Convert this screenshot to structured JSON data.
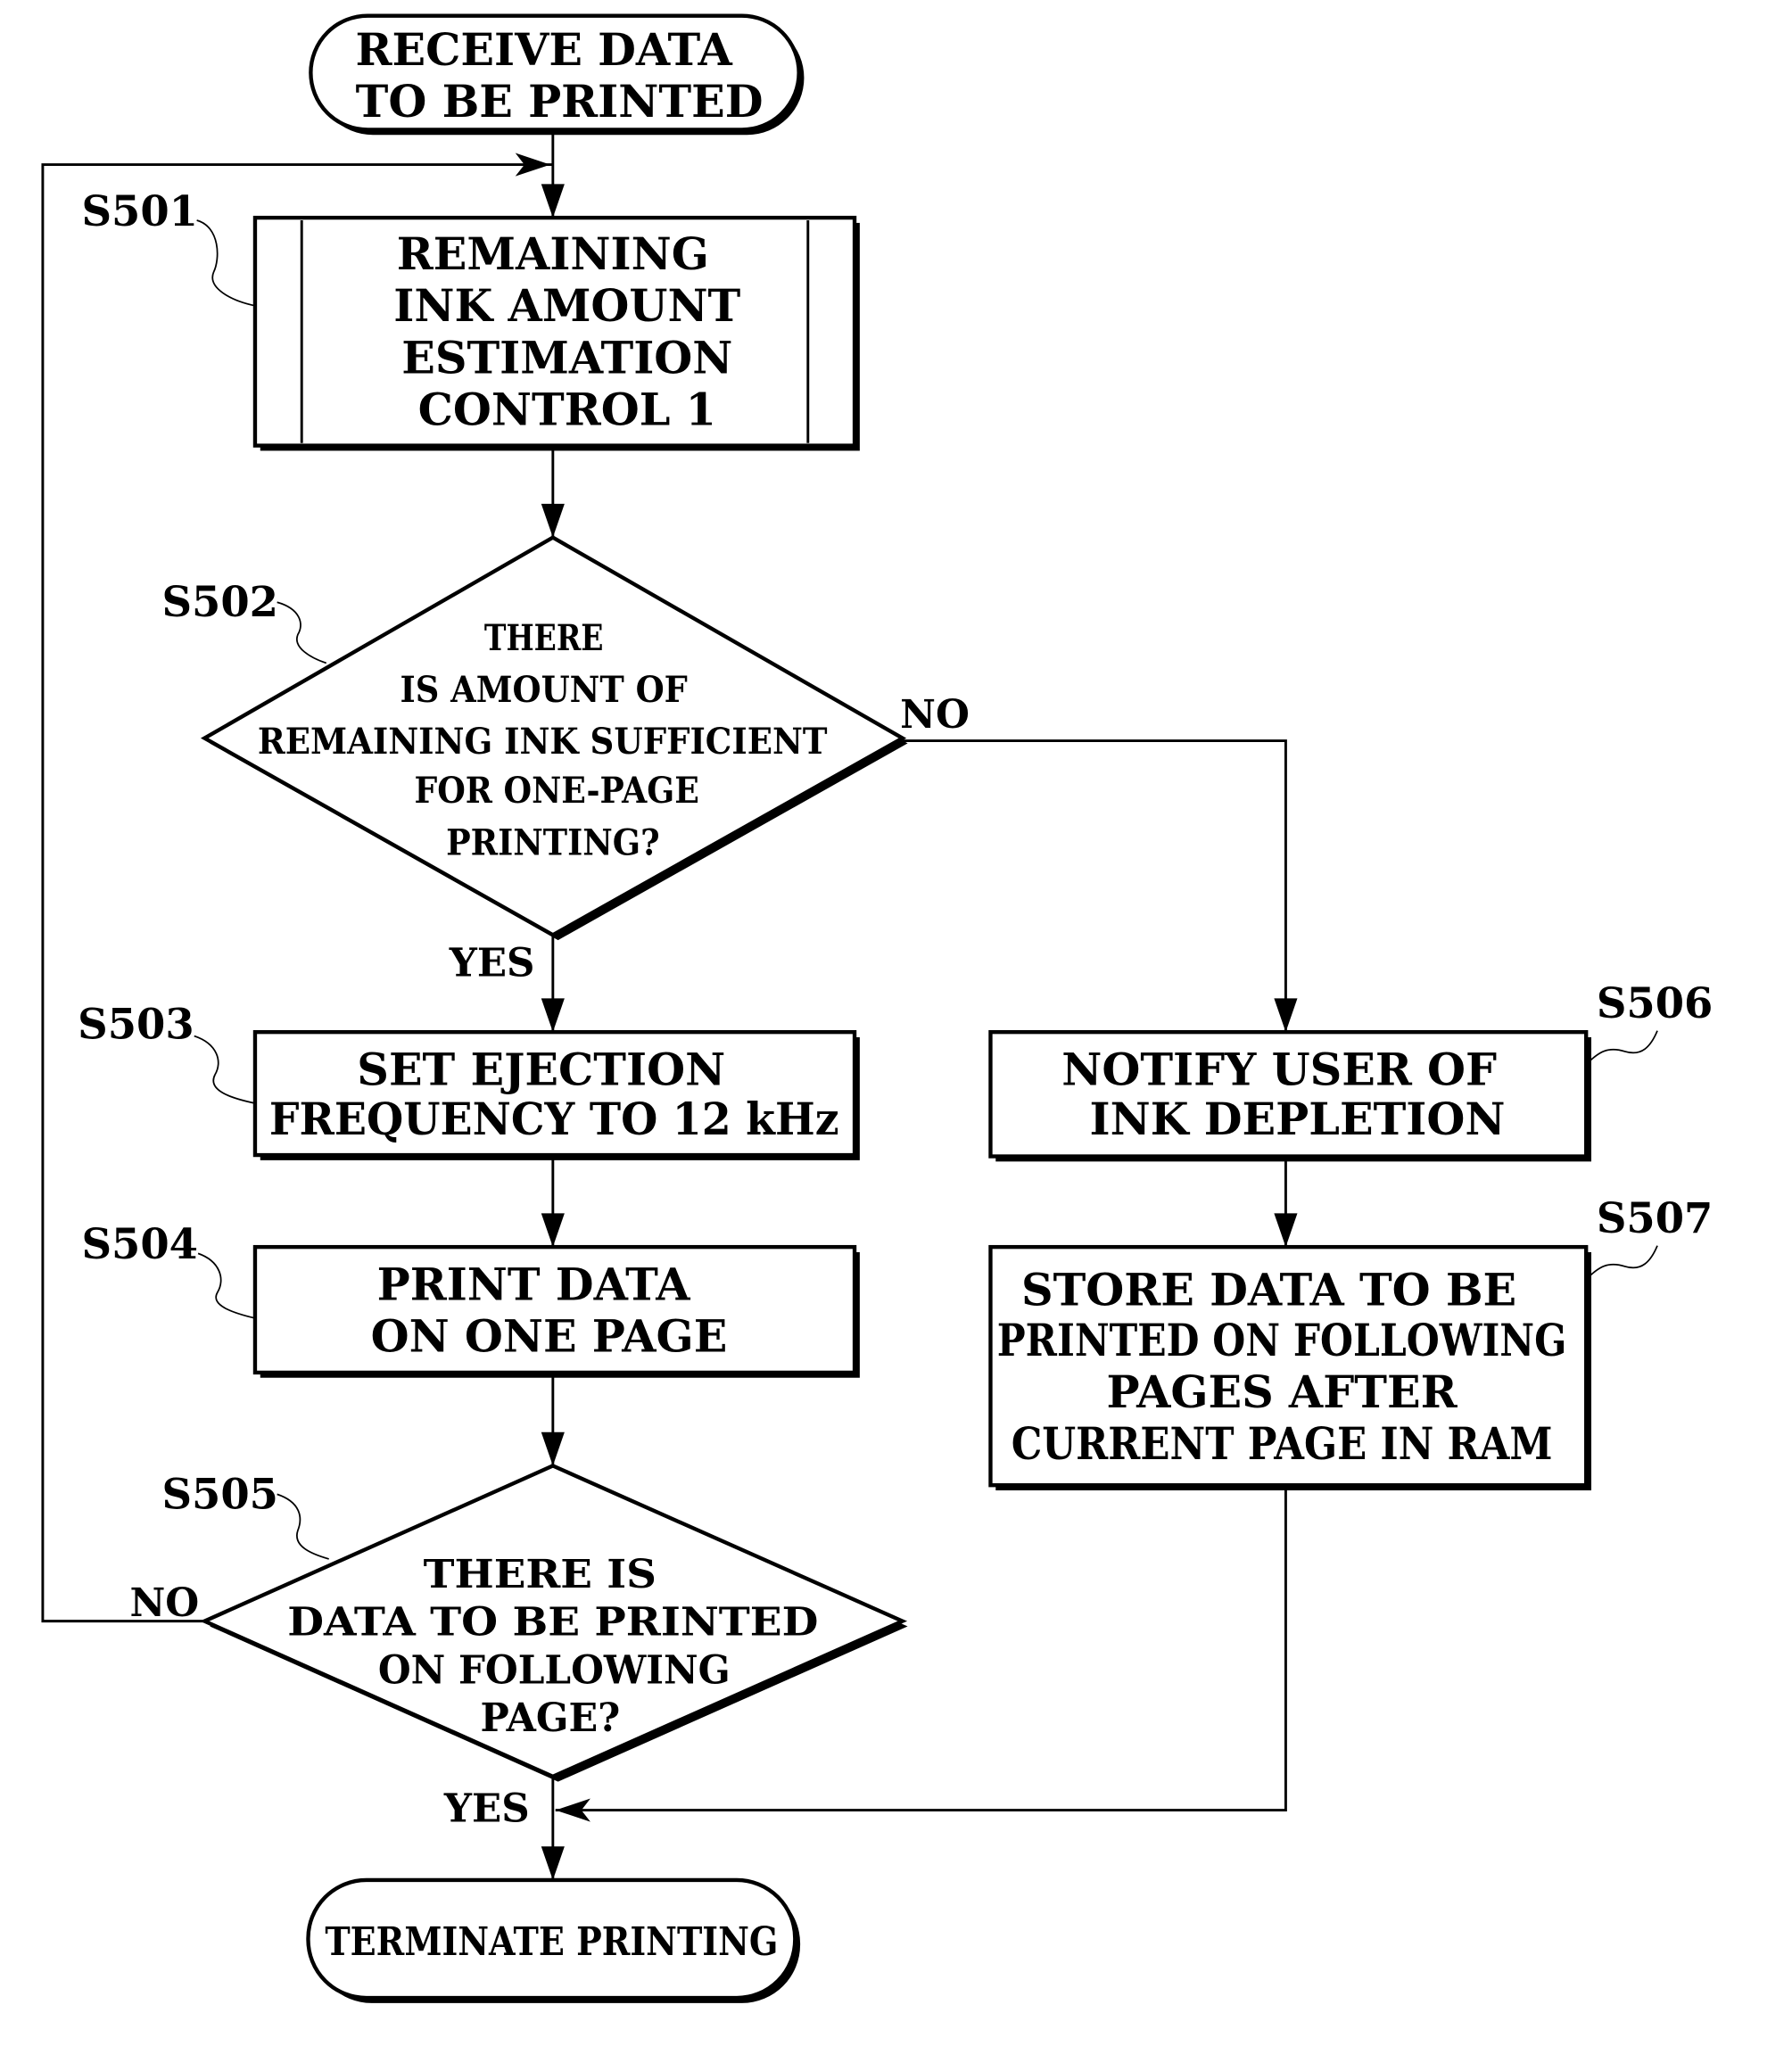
{
  "flowchart": {
    "start": {
      "lines": [
        "RECEIVE DATA",
        "TO BE PRINTED"
      ]
    },
    "end": {
      "lines": [
        "TERMINATE PRINTING"
      ]
    },
    "steps": {
      "s501": {
        "id": "S501",
        "lines": [
          "REMAINING",
          "INK AMOUNT",
          "ESTIMATION",
          "CONTROL 1"
        ],
        "type": "predefined-process"
      },
      "s502": {
        "id": "S502",
        "lines": [
          "THERE",
          "IS AMOUNT OF",
          "REMAINING INK SUFFICIENT",
          "FOR ONE-PAGE",
          "PRINTING?"
        ],
        "type": "decision",
        "yes_label": "YES",
        "no_label": "NO"
      },
      "s503": {
        "id": "S503",
        "lines": [
          "SET EJECTION",
          "FREQUENCY TO 12 kHz"
        ],
        "type": "process"
      },
      "s504": {
        "id": "S504",
        "lines": [
          "PRINT DATA",
          "ON ONE PAGE"
        ],
        "type": "process"
      },
      "s505": {
        "id": "S505",
        "lines": [
          "THERE IS",
          "DATA TO BE PRINTED",
          "ON FOLLOWING",
          "PAGE?"
        ],
        "type": "decision",
        "yes_label": "YES",
        "no_label": "NO"
      },
      "s506": {
        "id": "S506",
        "lines": [
          "NOTIFY USER OF",
          "INK DEPLETION"
        ],
        "type": "process"
      },
      "s507": {
        "id": "S507",
        "lines": [
          "STORE DATA TO BE",
          "PRINTED ON FOLLOWING",
          "PAGES AFTER",
          "CURRENT PAGE IN RAM"
        ],
        "type": "process"
      }
    }
  }
}
